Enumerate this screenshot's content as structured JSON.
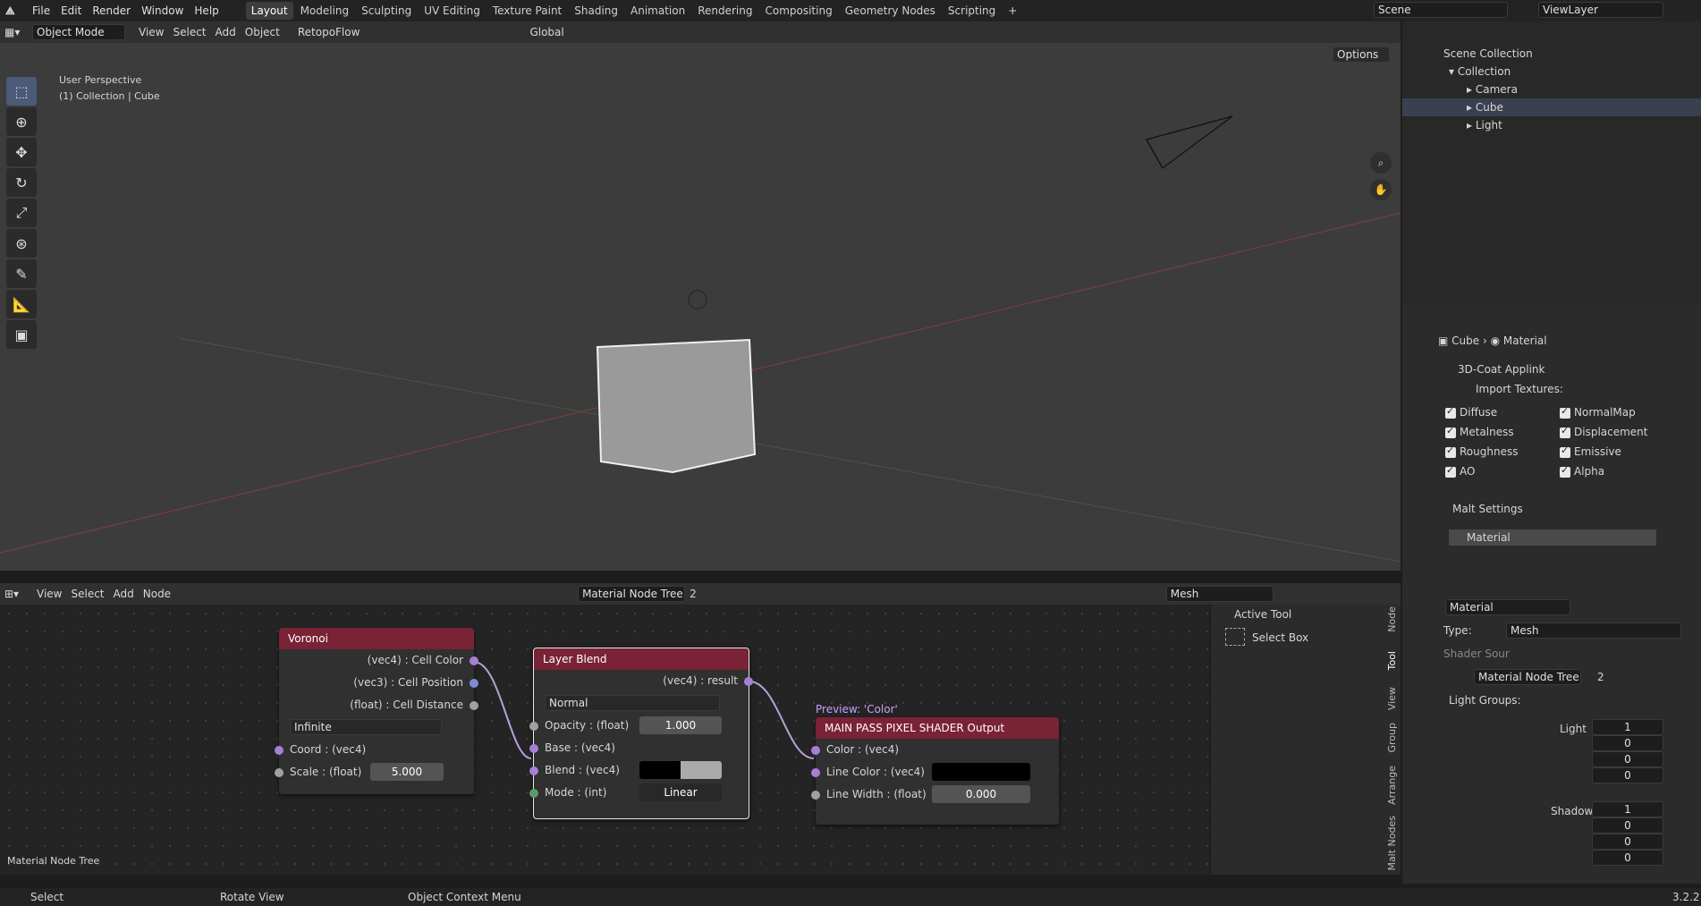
{
  "menu": {
    "file": "File",
    "edit": "Edit",
    "render": "Render",
    "window": "Window",
    "help": "Help"
  },
  "workspaces": [
    "Layout",
    "Modeling",
    "Sculpting",
    "UV Editing",
    "Texture Paint",
    "Shading",
    "Animation",
    "Rendering",
    "Compositing",
    "Geometry Nodes",
    "Scripting"
  ],
  "scene": {
    "name": "Scene",
    "view_layer": "ViewLayer"
  },
  "viewport": {
    "mode": "Object Mode",
    "view": "View",
    "select": "Select",
    "add": "Add",
    "object": "Object",
    "addon": "RetopoFlow",
    "orientation": "Global",
    "options": "Options",
    "perspective": "User Perspective",
    "collection_label": "(1) Collection | Cube"
  },
  "outliner": {
    "scene_collection": "Scene Collection",
    "collection": "Collection",
    "items": [
      "Camera",
      "Cube",
      "Light"
    ]
  },
  "props": {
    "breadcrumb_object": "Cube",
    "breadcrumb_material": "Material",
    "coat_panel": "3D-Coat Applink",
    "import_textures": "Import Textures:",
    "checks_left": [
      "Diffuse",
      "Metalness",
      "Roughness",
      "AO"
    ],
    "checks_right": [
      "NormalMap",
      "Displacement",
      "Emissive",
      "Alpha"
    ],
    "malt_settings": "Malt Settings",
    "material_slot": "Material",
    "material_name": "Material",
    "type_label": "Type:",
    "type_value": "Mesh",
    "shader_source": "Shader Sour",
    "tree_name": "Material Node Tree",
    "tree_users": "2",
    "light_groups": "Light Groups:",
    "light_label": "Light",
    "light_values": [
      "1",
      "0",
      "0",
      "0"
    ],
    "shadow_label": "Shadow",
    "shadow_values": [
      "1",
      "0",
      "0",
      "0"
    ]
  },
  "node_editor": {
    "view": "View",
    "select": "Select",
    "add": "Add",
    "node": "Node",
    "tree_name": "Material Node Tree",
    "tree_users": "2",
    "mesh": "Mesh",
    "footer_label": "Material Node Tree"
  },
  "ntab": {
    "active_tool": "Active Tool",
    "select_box": "Select Box",
    "tabs": [
      "Node",
      "Tool",
      "View",
      "Group",
      "Arrange",
      "Malt Nodes"
    ]
  },
  "voronoi": {
    "title": "Voronoi",
    "out1": "(vec4) : Cell Color",
    "out2": "(vec3) : Cell Position",
    "out3": "(float) : Cell Distance",
    "mode": "Infinite",
    "in1": "Coord : (vec4)",
    "in2": "Scale : (float)",
    "scale_value": "5.000"
  },
  "layer_blend": {
    "title": "Layer Blend",
    "out": "(vec4) : result",
    "blend_mode": "Normal",
    "in1": "Opacity : (float)",
    "opacity": "1.000",
    "in2": "Base : (vec4)",
    "in3": "Blend : (vec4)",
    "in4": "Mode : (int)",
    "mode_value": "Linear"
  },
  "output": {
    "preview": "Preview: 'Color'",
    "title": "MAIN PASS PIXEL SHADER Output",
    "in1": "Color : (vec4)",
    "in2": "Line Color : (vec4)",
    "in3": "Line Width : (float)",
    "line_width": "0.000"
  },
  "status": {
    "select": "Select",
    "rotate": "Rotate View",
    "context": "Object Context Menu",
    "version": "3.2.2"
  },
  "colors": {
    "node_header": "#7a2236",
    "accent": "#4772b3",
    "socket_vec": "#a67fd6",
    "socket_float": "#a1a1a1",
    "socket_int": "#5c9a6b"
  }
}
